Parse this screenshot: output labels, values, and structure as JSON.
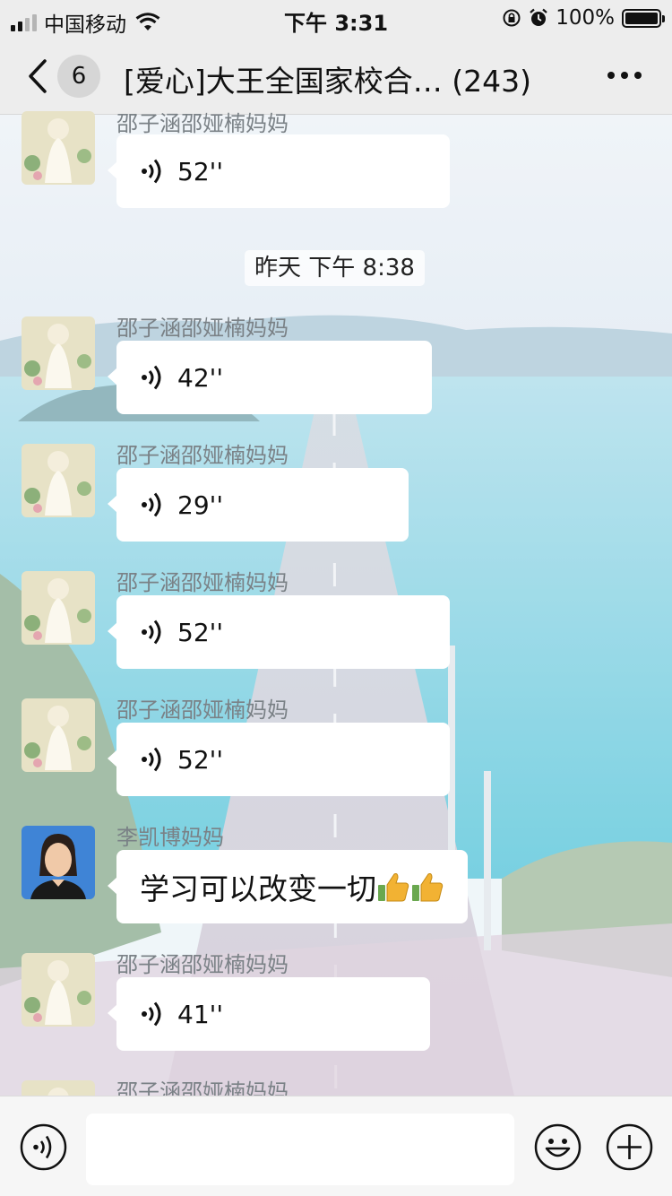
{
  "status_bar": {
    "carrier": "中国移动",
    "time": "下午 3:31",
    "battery": "100%"
  },
  "nav": {
    "unread_count": "6",
    "title": "[爱心]大王全国家校合…  (243)"
  },
  "time_separator": "昨天 下午 8:38",
  "messages": [
    {
      "sender": "邵子涵邵娅楠妈妈",
      "type": "voice",
      "duration": "52''"
    },
    {
      "sender": "邵子涵邵娅楠妈妈",
      "type": "voice",
      "duration": "42''"
    },
    {
      "sender": "邵子涵邵娅楠妈妈",
      "type": "voice",
      "duration": "29''"
    },
    {
      "sender": "邵子涵邵娅楠妈妈",
      "type": "voice",
      "duration": "52''"
    },
    {
      "sender": "邵子涵邵娅楠妈妈",
      "type": "voice",
      "duration": "52''"
    },
    {
      "sender": "李凯博妈妈",
      "type": "text",
      "text": "学习可以改变一切"
    },
    {
      "sender": "邵子涵邵娅楠妈妈",
      "type": "voice",
      "duration": "41''"
    },
    {
      "sender": "邵子涵邵娅楠妈妈",
      "type": "voice",
      "duration": ""
    }
  ],
  "input_bar": {
    "placeholder": ""
  },
  "icons": {
    "back": "chevron-left-icon",
    "more": "more-dots-icon",
    "voice": "voice-wave-icon",
    "emoji": "smiley-icon",
    "plus": "plus-circle-icon",
    "thumbs": "thumbs-up-icon"
  },
  "colors": {
    "bar_bg": "#ededed",
    "bubble_bg": "#ffffff",
    "sender_text": "#7a8186",
    "thumb": "#f2b233"
  }
}
